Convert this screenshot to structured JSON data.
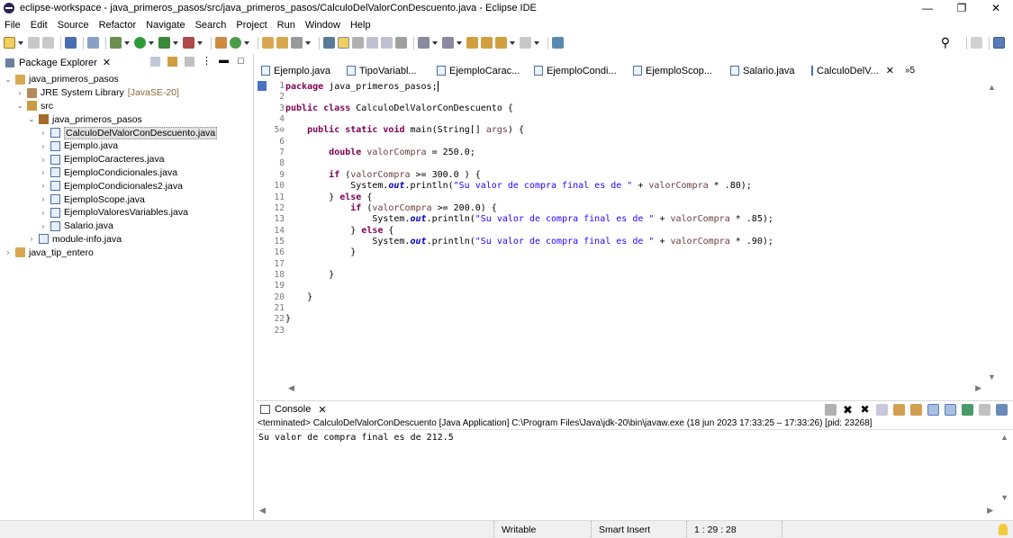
{
  "window": {
    "title": "eclipse-workspace - java_primeros_pasos/src/java_primeros_pasos/CalculoDelValorConDescuento.java - Eclipse IDE",
    "minimize": "—",
    "maximize": "❐",
    "close": "✕"
  },
  "menu": [
    "File",
    "Edit",
    "Source",
    "Refactor",
    "Navigate",
    "Search",
    "Project",
    "Run",
    "Window",
    "Help"
  ],
  "package_explorer": {
    "title": "Package Explorer",
    "tree": [
      {
        "label": "java_primeros_pasos",
        "level": 0,
        "icon": "project-icon",
        "expanded": true
      },
      {
        "label": "JRE System Library",
        "extra": "[JavaSE-20]",
        "level": 1,
        "icon": "library-icon",
        "expanded": false
      },
      {
        "label": "src",
        "level": 1,
        "icon": "source-folder-icon",
        "expanded": true
      },
      {
        "label": "java_primeros_pasos",
        "level": 2,
        "icon": "package-icon",
        "expanded": true
      },
      {
        "label": "CalculoDelValorConDescuento.java",
        "level": 3,
        "icon": "java-file-icon",
        "expanded": false,
        "selected": true
      },
      {
        "label": "Ejemplo.java",
        "level": 3,
        "icon": "java-file-icon",
        "expanded": false
      },
      {
        "label": "EjemploCaracteres.java",
        "level": 3,
        "icon": "java-file-icon",
        "expanded": false
      },
      {
        "label": "EjemploCondicionales.java",
        "level": 3,
        "icon": "java-file-icon",
        "expanded": false
      },
      {
        "label": "EjemploCondicionales2.java",
        "level": 3,
        "icon": "java-file-icon",
        "expanded": false
      },
      {
        "label": "EjemploScope.java",
        "level": 3,
        "icon": "java-file-icon",
        "expanded": false
      },
      {
        "label": "EjemploValoresVariables.java",
        "level": 3,
        "icon": "java-file-icon",
        "expanded": false
      },
      {
        "label": "Salario.java",
        "level": 3,
        "icon": "java-file-icon",
        "expanded": false
      },
      {
        "label": "module-info.java",
        "level": 2,
        "icon": "java-file-icon",
        "expanded": false
      },
      {
        "label": "java_tip_entero",
        "level": 0,
        "icon": "project-icon",
        "expanded": false
      }
    ]
  },
  "editor_tabs": [
    {
      "label": "Ejemplo.java",
      "active": false
    },
    {
      "label": "TipoVariabl...",
      "active": false
    },
    {
      "label": "EjemploCarac...",
      "active": false
    },
    {
      "label": "EjemploCondi...",
      "active": false
    },
    {
      "label": "EjemploScop...",
      "active": false
    },
    {
      "label": "Salario.java",
      "active": false
    },
    {
      "label": "CalculoDelV...",
      "active": true
    }
  ],
  "editor_tabs_more": "»5",
  "code_lines": [
    {
      "n": "1",
      "html": "<span class=\"kw\">package</span> java_primeros_pasos;<span class=\"caret\"></span>"
    },
    {
      "n": "2",
      "html": ""
    },
    {
      "n": "3",
      "html": "<span class=\"kw\">public</span> <span class=\"kw\">class</span> CalculoDelValorConDescuento {"
    },
    {
      "n": "4",
      "html": ""
    },
    {
      "n": "5⊖",
      "html": "    <span class=\"kw\">public</span> <span class=\"kw\">static</span> <span class=\"kw\">void</span> main(String[] <span class=\"var\">args</span>) {"
    },
    {
      "n": "6",
      "html": ""
    },
    {
      "n": "7",
      "html": "        <span class=\"kw\">double</span> <span class=\"var\">valorCompra</span> = 250.0;"
    },
    {
      "n": "8",
      "html": ""
    },
    {
      "n": "9",
      "html": "        <span class=\"kw\">if</span> (<span class=\"var\">valorCompra</span> &gt;= 300.0 ) {"
    },
    {
      "n": "10",
      "html": "            System.<span class=\"fld\">out</span>.println(<span class=\"str\">\"Su valor de compra final es de \"</span> + <span class=\"var\">valorCompra</span> * .80);"
    },
    {
      "n": "11",
      "html": "        } <span class=\"kw\">else</span> {"
    },
    {
      "n": "12",
      "html": "            <span class=\"kw\">if</span> (<span class=\"var\">valorCompra</span> &gt;= 200.0) {"
    },
    {
      "n": "13",
      "html": "                System.<span class=\"fld\">out</span>.println(<span class=\"str\">\"Su valor de compra final es de \"</span> + <span class=\"var\">valorCompra</span> * .85);"
    },
    {
      "n": "14",
      "html": "            } <span class=\"kw\">else</span> {"
    },
    {
      "n": "15",
      "html": "                System.<span class=\"fld\">out</span>.println(<span class=\"str\">\"Su valor de compra final es de \"</span> + <span class=\"var\">valorCompra</span> * .90);"
    },
    {
      "n": "16",
      "html": "            }"
    },
    {
      "n": "17",
      "html": ""
    },
    {
      "n": "18",
      "html": "        }"
    },
    {
      "n": "19",
      "html": ""
    },
    {
      "n": "20",
      "html": "    }"
    },
    {
      "n": "21",
      "html": ""
    },
    {
      "n": "22",
      "html": "}"
    },
    {
      "n": "23",
      "html": ""
    }
  ],
  "console": {
    "title": "Console",
    "status": "<terminated> CalculoDelValorConDescuento [Java Application] C:\\Program Files\\Java\\jdk-20\\bin\\javaw.exe  (18 jun 2023 17:33:25 – 17:33:26) [pid: 23268]",
    "output": "Su valor de compra final es de 212.5"
  },
  "statusbar": {
    "writable": "Writable",
    "insert_mode": "Smart Insert",
    "position": "1 : 29 : 28"
  },
  "colors": {
    "keyword": "#7f0055",
    "string": "#2a00ff",
    "field": "#0000c0",
    "variable": "#6a3e3e"
  }
}
